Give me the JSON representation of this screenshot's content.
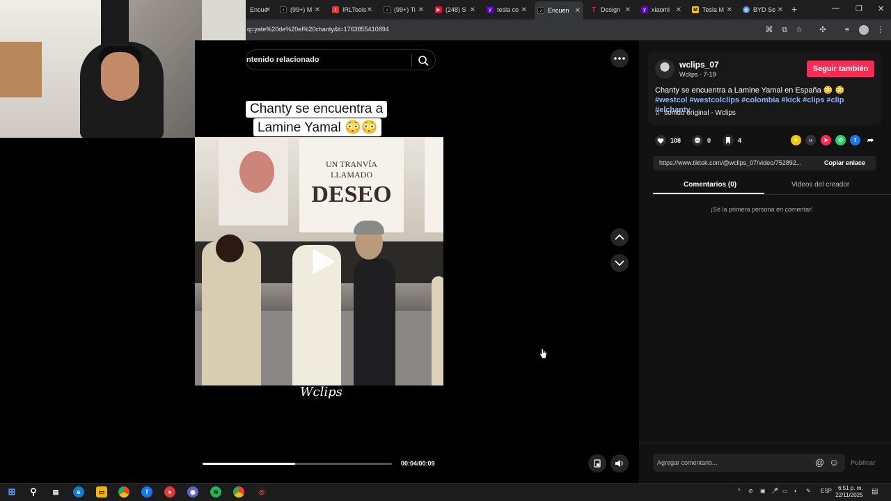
{
  "browser": {
    "tabs": [
      {
        "label": "Encuentra",
        "icon": "tiktok-icon",
        "color": "#111111"
      },
      {
        "label": "(99+) M",
        "icon": "tiktok-icon",
        "color": "#111111"
      },
      {
        "label": "IRLTools",
        "icon": "irltools-icon",
        "color": "#e53935"
      },
      {
        "label": "(99+) Ti",
        "icon": "tiktok-icon",
        "color": "#111111"
      },
      {
        "label": "(248) S",
        "icon": "youtube-icon",
        "color": "#ff0033"
      },
      {
        "label": "tesla co",
        "icon": "yahoo-icon",
        "color": "#6001d2"
      },
      {
        "label": "Encuen",
        "icon": "tiktok-icon",
        "color": "#111111",
        "active": true
      },
      {
        "label": "Design",
        "icon": "tesla-icon",
        "color": "#e82127"
      },
      {
        "label": "xiaomi",
        "icon": "yahoo-icon",
        "color": "#6001d2"
      },
      {
        "label": "Tesla M",
        "icon": "tesla-m-icon",
        "color": "#f5c400"
      },
      {
        "label": "BYD Se",
        "icon": "globe-icon",
        "color": "#4a90e2"
      }
    ],
    "url": "q=yate%20de%20el%20chanty&t=1763855410894"
  },
  "search": {
    "placeholder": "ntenido relacionado"
  },
  "video": {
    "caption_line1": "Chanty se encuentra a",
    "caption_line2": "Lamine Yamal 😳😳",
    "poster_text_small": "UN TRANVÍA LLAMADO",
    "poster_text_big": "DESEO",
    "watermark": "Wclips",
    "timecode": "00:04/00:09",
    "progress": 0.49
  },
  "creator": {
    "username": "wclips_07",
    "subline": "Wclips · 7-19",
    "follow_label": "Seguir también",
    "description_text": "Chanty se encuentra a Lamine Yamal en España 😳 😳 ",
    "description_tags": "#westcol #westcolclips #colombia #kick #clips #clip #elchanty",
    "sound": "sonido original - Wclips"
  },
  "stats": {
    "likes": "108",
    "comments": "0",
    "saves": "4"
  },
  "share": {
    "link": "https://www.tiktok.com/@wclips_07/video/752892...",
    "copy_label": "Copiar enlace"
  },
  "tabs": {
    "comments": "Comentarios (0)",
    "creator_videos": "Videos del creador"
  },
  "comments": {
    "empty": "¡Sé la primera persona en comentar!",
    "placeholder": "Agregar comentario...",
    "publish": "Publicar"
  },
  "taskbar": {
    "lang": "ESP",
    "time": "6:51 p. m.",
    "date": "22/11/2025"
  },
  "colors": {
    "accent": "#fe2c55",
    "tag": "#8ab4f8"
  }
}
